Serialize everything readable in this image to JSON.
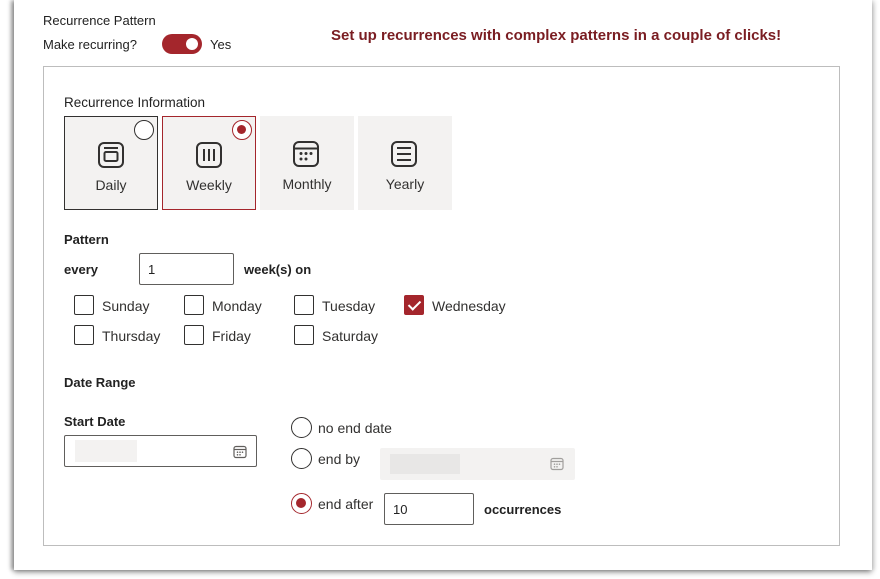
{
  "header": {
    "section_title": "Recurrence Pattern",
    "make_recurring_label": "Make recurring?",
    "toggle_value": "Yes",
    "promo": "Set up recurrences with complex patterns in a couple of clicks!"
  },
  "recurrence": {
    "title": "Recurrence Information",
    "options": [
      {
        "label": "Daily",
        "selected": false
      },
      {
        "label": "Weekly",
        "selected": true
      },
      {
        "label": "Monthly",
        "selected": false
      },
      {
        "label": "Yearly",
        "selected": false
      }
    ]
  },
  "pattern": {
    "title": "Pattern",
    "every_label": "every",
    "every_value": "1",
    "unit_label": "week(s) on",
    "days": [
      {
        "label": "Sunday",
        "checked": false
      },
      {
        "label": "Monday",
        "checked": false
      },
      {
        "label": "Tuesday",
        "checked": false
      },
      {
        "label": "Wednesday",
        "checked": true
      },
      {
        "label": "Thursday",
        "checked": false
      },
      {
        "label": "Friday",
        "checked": false
      },
      {
        "label": "Saturday",
        "checked": false
      }
    ]
  },
  "date_range": {
    "title": "Date Range",
    "start_label": "Start Date",
    "start_value": "",
    "end_options": [
      {
        "label": "no end date",
        "selected": false
      },
      {
        "label": "end by",
        "selected": false
      },
      {
        "label": "end after",
        "selected": true
      }
    ],
    "end_by_value": "",
    "occurrences_value": "10",
    "occurrences_label": "occurrences"
  },
  "colors": {
    "accent": "#a4262c",
    "promo": "#7a1d22",
    "tile_bg": "#f3f2f1"
  }
}
